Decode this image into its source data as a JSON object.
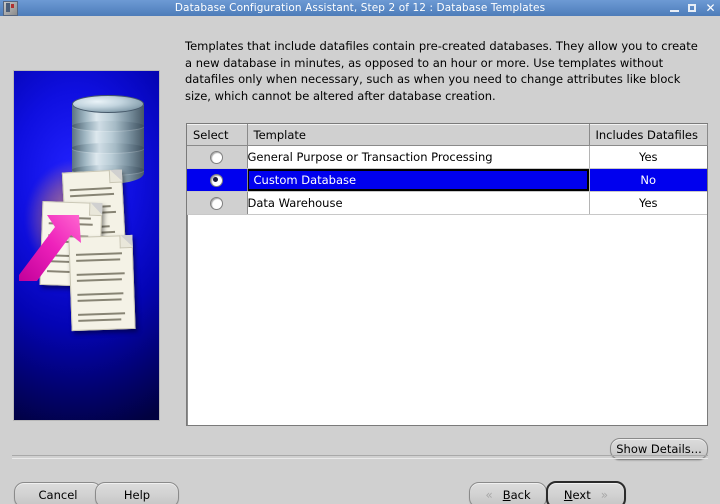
{
  "window": {
    "title": "Database Configuration Assistant, Step 2 of 12 : Database Templates",
    "icon": "app-icon",
    "minimize_label": "–",
    "maximize_label": "□",
    "close_label": "✕"
  },
  "main": {
    "intro": "Templates that include datafiles contain pre-created databases. They allow you to create a new database in minutes, as opposed to an hour or more. Use templates without datafiles only when necessary, such as when you need to change attributes like block size, which cannot be altered after database creation."
  },
  "table": {
    "columns": [
      "Select",
      "Template",
      "Includes Datafiles"
    ],
    "rows": [
      {
        "selected": false,
        "template": "General Purpose or Transaction Processing",
        "includes_datafiles": "Yes"
      },
      {
        "selected": true,
        "template": "Custom Database",
        "includes_datafiles": "No"
      },
      {
        "selected": false,
        "template": "Data Warehouse",
        "includes_datafiles": "Yes"
      }
    ]
  },
  "buttons": {
    "show_details": "Show Details...",
    "cancel": "Cancel",
    "help": "Help",
    "back_mnemonic": "B",
    "back_rest": "ack",
    "back_chevron": "«",
    "next_mnemonic": "N",
    "next_rest": "ext",
    "next_chevron": "»"
  },
  "colors": {
    "titlebar": "#5b8ac6",
    "selection": "#0000ee",
    "window_bg": "#d0d0d0",
    "panel_blue": "#0f0fe0",
    "arrow_magenta": "#ee22bb"
  }
}
